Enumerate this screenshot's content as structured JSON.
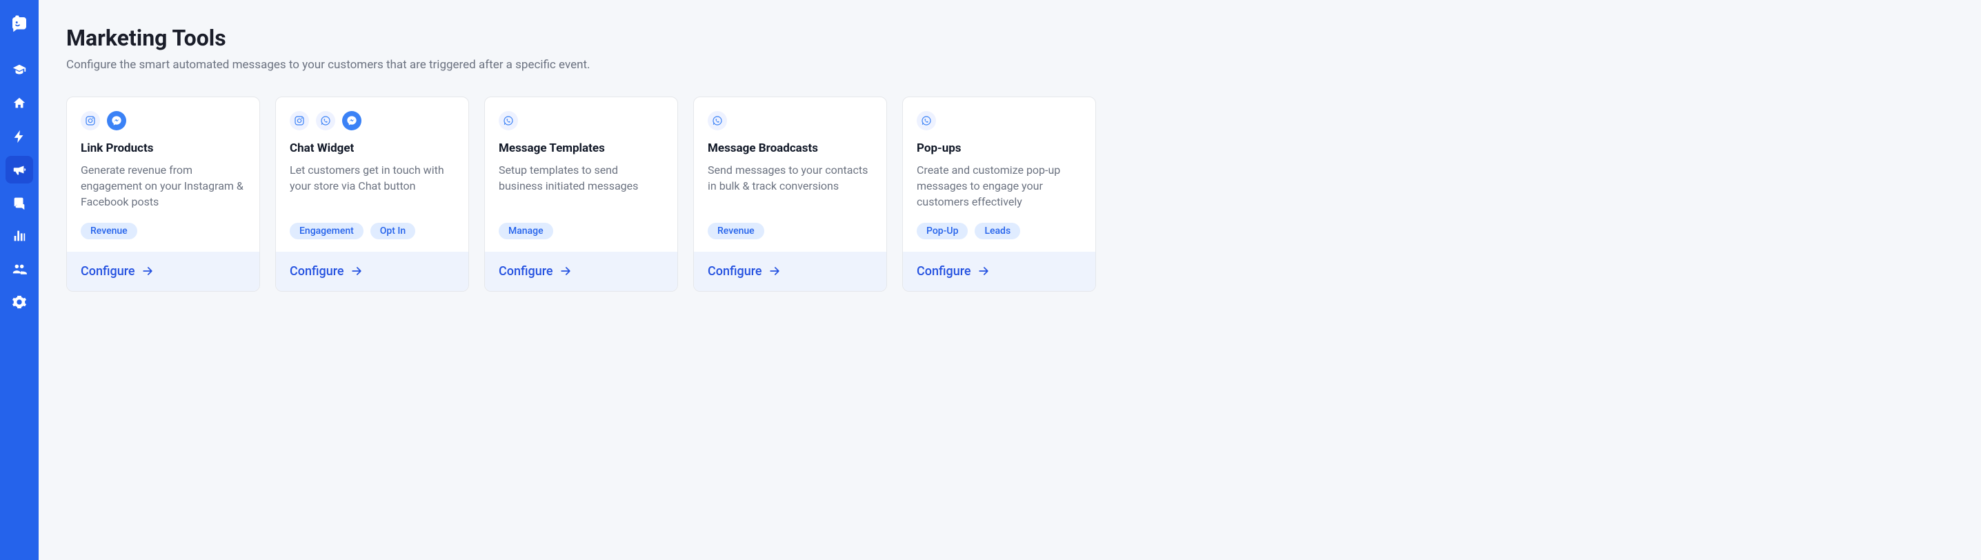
{
  "sidebar": {
    "items": [
      {
        "name": "education-icon"
      },
      {
        "name": "home-icon"
      },
      {
        "name": "bolt-icon"
      },
      {
        "name": "megaphone-icon",
        "active": true
      },
      {
        "name": "chat-icon"
      },
      {
        "name": "bar-chart-icon"
      },
      {
        "name": "people-icon"
      },
      {
        "name": "settings-icon"
      }
    ]
  },
  "header": {
    "title": "Marketing Tools",
    "subtitle": "Configure the smart automated messages to your customers that are triggered after a specific event."
  },
  "cards": [
    {
      "icons": [
        "instagram",
        "messenger"
      ],
      "title": "Link Products",
      "desc": "Generate revenue from engagement on your Instagram & Facebook posts",
      "tags": [
        "Revenue"
      ],
      "cta": "Configure"
    },
    {
      "icons": [
        "instagram",
        "whatsapp",
        "messenger"
      ],
      "title": "Chat Widget",
      "desc": "Let customers get in touch with your store via Chat button",
      "tags": [
        "Engagement",
        "Opt In"
      ],
      "cta": "Configure"
    },
    {
      "icons": [
        "whatsapp"
      ],
      "title": "Message Templates",
      "desc": "Setup templates to send business initiated messages",
      "tags": [
        "Manage"
      ],
      "cta": "Configure"
    },
    {
      "icons": [
        "whatsapp"
      ],
      "title": "Message Broadcasts",
      "desc": "Send messages to your contacts in bulk & track conversions",
      "tags": [
        "Revenue"
      ],
      "cta": "Configure"
    },
    {
      "icons": [
        "whatsapp"
      ],
      "title": "Pop-ups",
      "desc": "Create and customize pop-up messages to engage your customers effectively",
      "tags": [
        "Pop-Up",
        "Leads"
      ],
      "cta": "Configure"
    }
  ]
}
